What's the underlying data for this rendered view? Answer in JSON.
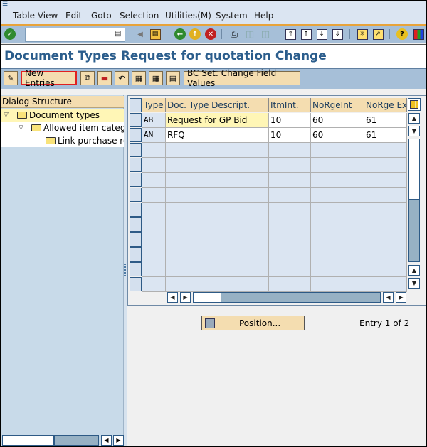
{
  "menubar": {
    "items": [
      {
        "label": "Table View"
      },
      {
        "label": "Edit"
      },
      {
        "label": "Goto"
      },
      {
        "label": "Selection"
      },
      {
        "label": "Utilities(M)"
      },
      {
        "label": "System"
      },
      {
        "label": "Help"
      }
    ]
  },
  "toolbar": {
    "command_field_value": "",
    "icons": [
      "enter-icon",
      "back-arrow-icon",
      "save-icon",
      "back-icon",
      "exit-icon",
      "cancel-icon",
      "print-icon",
      "find-icon",
      "find-next-icon",
      "first-page-icon",
      "previous-page-icon",
      "next-page-icon",
      "last-page-icon",
      "create-session-icon",
      "shortcut-icon",
      "help-icon",
      "customize-layout-icon"
    ]
  },
  "page": {
    "title": "Document Types Request for quotation Change"
  },
  "app_toolbar": {
    "new_entries_label": "New Entries",
    "bc_set_label": "BC Set: Change Field Values"
  },
  "dialog_structure": {
    "header": "Dialog Structure",
    "items": [
      {
        "label": "Document types",
        "level": 0,
        "expanded": true,
        "selected": true
      },
      {
        "label": "Allowed item catego",
        "level": 1,
        "expanded": true,
        "selected": false
      },
      {
        "label": "Link purchase rec",
        "level": 2,
        "expanded": false,
        "selected": false
      }
    ]
  },
  "table": {
    "columns": [
      "Type",
      "Doc. Type Descript.",
      "ItmInt.",
      "NoRgeInt",
      "NoRge Ext"
    ],
    "rows": [
      [
        "AB",
        "Request for GP Bid",
        "10",
        "60",
        "61"
      ],
      [
        "AN",
        "RFQ",
        "10",
        "60",
        "61"
      ]
    ],
    "empty_rows": 10
  },
  "footer": {
    "position_label": "Position...",
    "entry_text": "Entry 1 of 2"
  },
  "colors": {
    "title": "#2b5d8c",
    "button_bg": "#f4ddb0",
    "highlight_border": "#e02020",
    "toolbar_bg": "#a6bfd8",
    "separator_orange": "#e8a33a"
  }
}
